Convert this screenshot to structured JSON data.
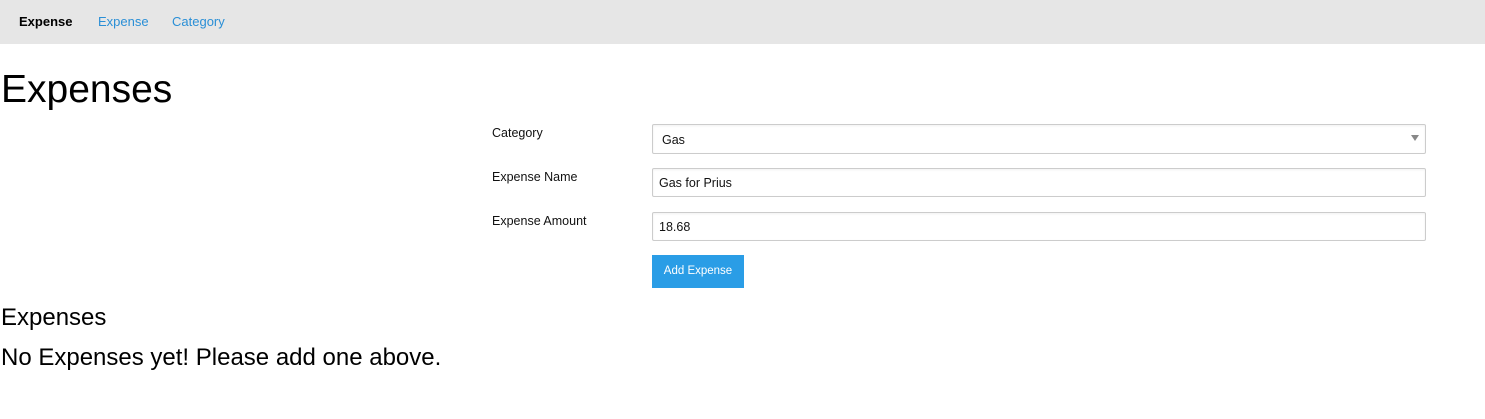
{
  "nav": {
    "brand": "Expense",
    "links": [
      "Expense",
      "Category"
    ]
  },
  "page": {
    "title": "Expenses"
  },
  "form": {
    "category_label": "Category",
    "category_value": "Gas",
    "name_label": "Expense Name",
    "name_value": "Gas for Prius",
    "amount_label": "Expense Amount",
    "amount_value": "18.68",
    "submit_label": "Add Expense"
  },
  "list": {
    "title": "Expenses",
    "empty_message": "No Expenses yet! Please add one above."
  },
  "icons": {
    "select_arrow": "chevron-down-icon"
  },
  "colors": {
    "navbar_bg": "#e6e6e6",
    "link": "#2a8fd6",
    "button": "#2a9de6"
  }
}
